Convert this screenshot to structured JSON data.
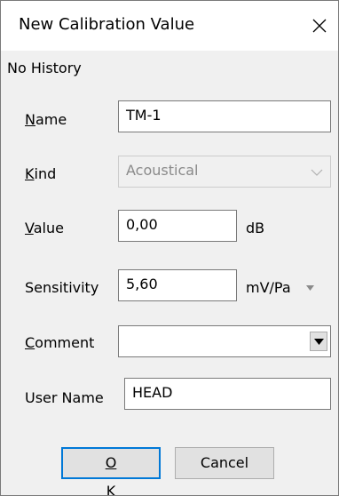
{
  "window": {
    "title": "New Calibration Value",
    "status": "No History"
  },
  "form": {
    "name_label": {
      "mnemonic": "N",
      "rest": "ame"
    },
    "name_value": "TM-1",
    "kind_label": {
      "mnemonic": "K",
      "rest": "ind"
    },
    "kind_value": "Acoustical",
    "value_label": {
      "mnemonic": "V",
      "rest": "alue"
    },
    "value_value": "0,00",
    "value_unit": "dB",
    "sensitivity_label": "Sensitivity",
    "sensitivity_value": "5,60",
    "sensitivity_unit": "mV/Pa",
    "comment_label": {
      "mnemonic": "C",
      "rest": "omment"
    },
    "comment_value": "",
    "username_label": "User Name",
    "username_value": "HEAD"
  },
  "buttons": {
    "ok": {
      "mnemonic": "O",
      "rest": "K"
    },
    "cancel": "Cancel"
  },
  "icons": {
    "close": "close-icon",
    "kind_dropdown": "chevron-down-icon",
    "sensitivity_unit_dropdown": "triangle-down-icon",
    "comment_dropdown": "triangle-down-icon"
  }
}
